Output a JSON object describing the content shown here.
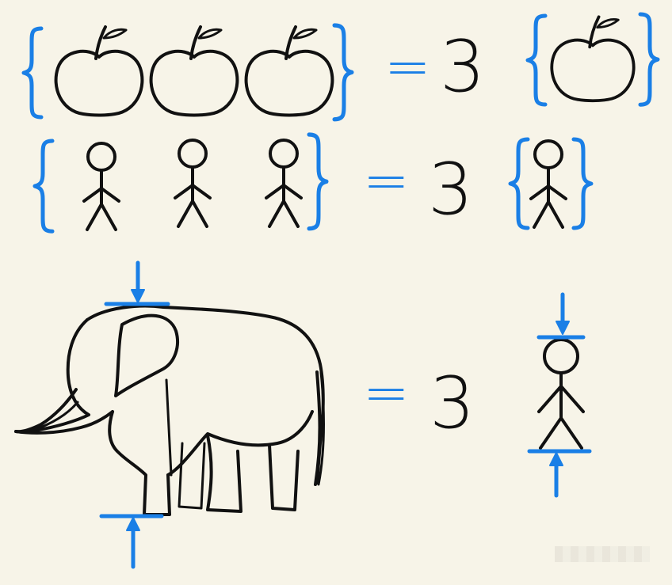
{
  "rows": [
    {
      "id": "apples",
      "equals": "=",
      "value": "3"
    },
    {
      "id": "people",
      "equals": "=",
      "value": "3"
    },
    {
      "id": "heights",
      "equals": "=",
      "value": "3"
    }
  ],
  "colors": {
    "ink": "#111111",
    "accent": "#1a7fe6",
    "background": "#f7f4e8"
  },
  "icons": [
    "apple-icon",
    "stick-figure-icon",
    "elephant-icon",
    "curly-brace-icon",
    "arrow-icon"
  ]
}
